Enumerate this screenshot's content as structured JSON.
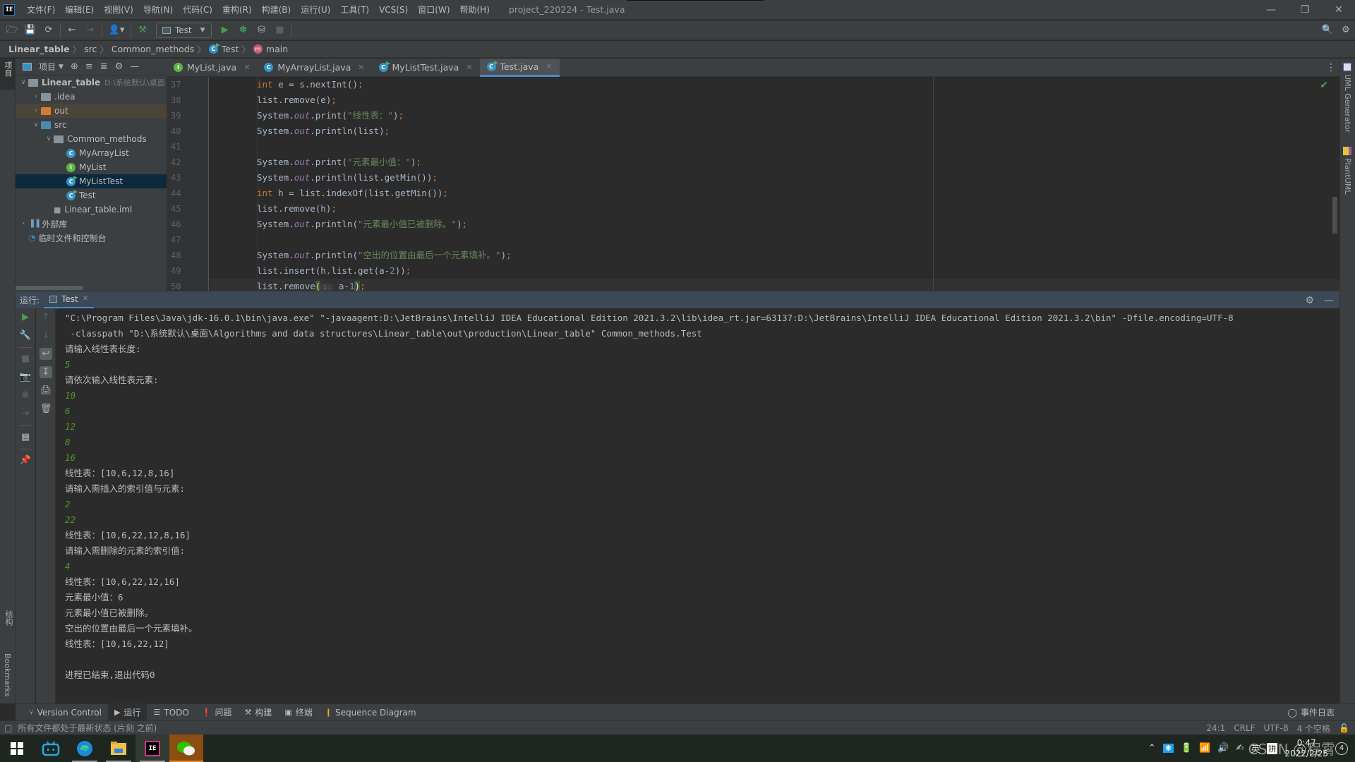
{
  "window": {
    "title": "project_220224 - Test.java",
    "logo": "IE",
    "controls": [
      "minimize",
      "restore",
      "close"
    ]
  },
  "menu": [
    "文件(F)",
    "编辑(E)",
    "视图(V)",
    "导航(N)",
    "代码(C)",
    "重构(R)",
    "构建(B)",
    "运行(U)",
    "工具(T)",
    "VCS(S)",
    "窗口(W)",
    "帮助(H)"
  ],
  "toolbar": {
    "run_config": "Test"
  },
  "breadcrumb": [
    "Linear_table",
    "src",
    "Common_methods",
    "Test",
    "main"
  ],
  "left_stripe": {
    "project_label": "项目",
    "structure_label": "结构",
    "bookmarks_label": "Bookmarks"
  },
  "right_stripe": {
    "uml_generator": "UML Generator",
    "plantuml": "PlantUML"
  },
  "project_panel": {
    "view_label": "项目",
    "tree": [
      {
        "label": "Linear_table",
        "hint": "D:\\系统默认\\桌面",
        "type": "module",
        "depth": 0,
        "expanded": true
      },
      {
        "label": ".idea",
        "type": "folder",
        "depth": 1,
        "expanded": false
      },
      {
        "label": "out",
        "type": "folder-out",
        "depth": 1,
        "expanded": false
      },
      {
        "label": "src",
        "type": "folder-src",
        "depth": 1,
        "expanded": true
      },
      {
        "label": "Common_methods",
        "type": "package",
        "depth": 2,
        "expanded": true
      },
      {
        "label": "MyArrayList",
        "type": "class",
        "depth": 3
      },
      {
        "label": "MyList",
        "type": "interface",
        "depth": 3
      },
      {
        "label": "MyListTest",
        "type": "class-run",
        "depth": 3,
        "selected": true
      },
      {
        "label": "Test",
        "type": "class-run",
        "depth": 3
      },
      {
        "label": "Linear_table.iml",
        "type": "file",
        "depth": 2
      },
      {
        "label": "外部库",
        "type": "libraries",
        "depth": 0,
        "expanded": false
      },
      {
        "label": "临时文件和控制台",
        "type": "scratches",
        "depth": 0
      }
    ]
  },
  "editor": {
    "tabs": [
      {
        "label": "MyList.java",
        "icon": "interface",
        "active": false
      },
      {
        "label": "MyArrayList.java",
        "icon": "class",
        "active": false
      },
      {
        "label": "MyListTest.java",
        "icon": "class-run",
        "active": false
      },
      {
        "label": "Test.java",
        "icon": "class-run",
        "active": true
      }
    ],
    "line_numbers": [
      "37",
      "38",
      "39",
      "40",
      "41",
      "42",
      "43",
      "44",
      "45",
      "46",
      "47",
      "48",
      "49",
      "50"
    ],
    "lines": [
      "int e = s.nextInt();",
      "list.remove(e);",
      "System.out.print(\"线性表：\");",
      "System.out.println(list);",
      "",
      "System.out.print(\"元素最小值：\");",
      "System.out.println(list.getMin());",
      "int h = list.indexOf(list.getMin());",
      "list.remove(h);",
      "System.out.println(\"元素最小值已被删除。\");",
      "",
      "System.out.println(\"空出的位置由最后一个元素填补。\");",
      "list.insert(h,list.get(a-2));",
      "list.remove( i: a-1);"
    ],
    "param_hint": "i:",
    "status": "no-problems-check"
  },
  "run_panel": {
    "label": "运行:",
    "tab": "Test",
    "console": [
      {
        "text": "\"C:\\Program Files\\Java\\jdk-16.0.1\\bin\\java.exe\" \"-javaagent:D:\\JetBrains\\IntelliJ IDEA Educational Edition 2021.3.2\\lib\\idea_rt.jar=63137:D:\\JetBrains\\IntelliJ IDEA Educational Edition 2021.3.2\\bin\" -Dfile.encoding=UTF-8",
        "kind": "output"
      },
      {
        "text": " -classpath \"D:\\系统默认\\桌面\\Algorithms and data structures\\Linear_table\\out\\production\\Linear_table\" Common_methods.Test",
        "kind": "output"
      },
      {
        "text": "请输入线性表长度:",
        "kind": "output"
      },
      {
        "text": "5",
        "kind": "input"
      },
      {
        "text": "请依次输入线性表元素:",
        "kind": "output"
      },
      {
        "text": "10",
        "kind": "input"
      },
      {
        "text": "6",
        "kind": "input"
      },
      {
        "text": "12",
        "kind": "input"
      },
      {
        "text": "8",
        "kind": "input"
      },
      {
        "text": "16",
        "kind": "input"
      },
      {
        "text": "线性表：[10,6,12,8,16]",
        "kind": "output"
      },
      {
        "text": "请输入需插入的索引值与元素:",
        "kind": "output"
      },
      {
        "text": "2",
        "kind": "input"
      },
      {
        "text": "22",
        "kind": "input"
      },
      {
        "text": "线性表：[10,6,22,12,8,16]",
        "kind": "output"
      },
      {
        "text": "请输入需删除的元素的索引值:",
        "kind": "output"
      },
      {
        "text": "4",
        "kind": "input"
      },
      {
        "text": "线性表：[10,6,22,12,16]",
        "kind": "output"
      },
      {
        "text": "元素最小值：6",
        "kind": "output"
      },
      {
        "text": "元素最小值已被删除。",
        "kind": "output"
      },
      {
        "text": "空出的位置由最后一个元素填补。",
        "kind": "output"
      },
      {
        "text": "线性表：[10,16,22,12]",
        "kind": "output"
      },
      {
        "text": "",
        "kind": "output"
      },
      {
        "text": "进程已结束,退出代码0",
        "kind": "output"
      }
    ]
  },
  "bottom_tabs": [
    {
      "label": "Version Control",
      "icon": "vcs-icon"
    },
    {
      "label": "运行",
      "icon": "run-icon",
      "active": true
    },
    {
      "label": "TODO",
      "icon": "list-icon"
    },
    {
      "label": "问题",
      "icon": "problems-icon"
    },
    {
      "label": "构建",
      "icon": "hammer-icon"
    },
    {
      "label": "终端",
      "icon": "terminal-icon"
    },
    {
      "label": "Sequence Diagram",
      "icon": "sequence-icon"
    }
  ],
  "event_log": "事件日志",
  "statusbar": {
    "message": "所有文件都处于最新状态 (片刻 之前)",
    "position": "24:1",
    "line_sep": "CRLF",
    "encoding": "UTF-8",
    "indent": "4 个空格"
  },
  "taskbar": {
    "apps": [
      "windows-start",
      "bilibili",
      "edge",
      "file-explorer",
      "intellij-idea",
      "wechat"
    ],
    "tray": {
      "ime_lang": "英",
      "ime_mode": "拼",
      "time": "0:47",
      "date": "2022/2/25",
      "notifications": "4"
    }
  },
  "watermark": "CSDN @程霄"
}
